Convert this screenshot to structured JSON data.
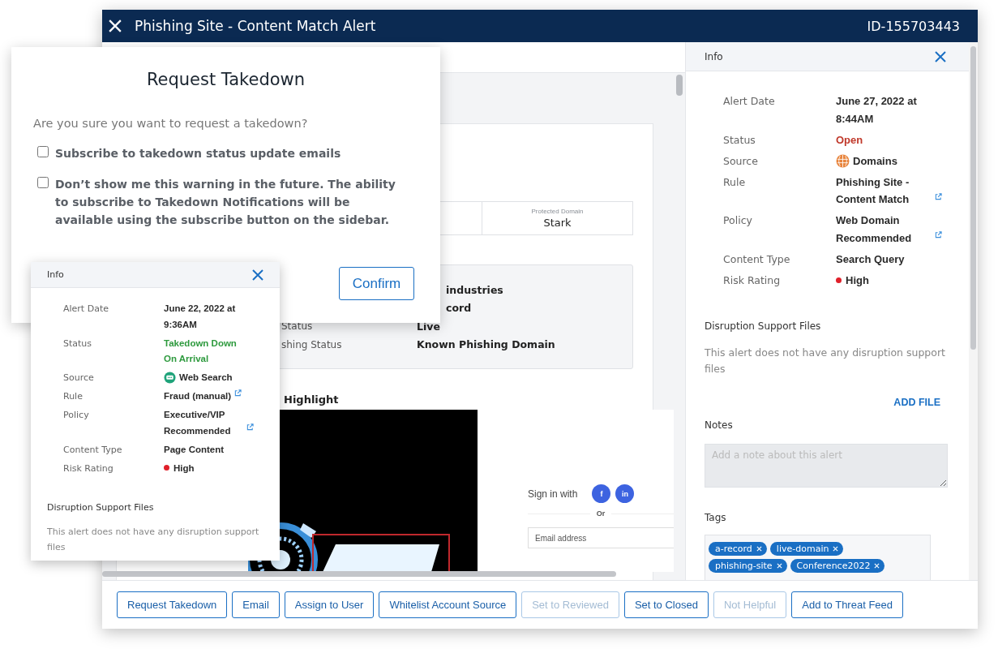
{
  "window": {
    "title": "Phishing Site - Content Match Alert",
    "id": "ID-155703443"
  },
  "alert_content": {
    "protected_domain": {
      "label": "Protected Domain",
      "value": "Stark"
    },
    "details": [
      {
        "value": "industries"
      },
      {
        "value": "cord"
      },
      {
        "label": "Status",
        "value": "Live"
      },
      {
        "label": "shing Status",
        "value": "Known Phishing Domain"
      }
    ],
    "highlight": {
      "title": "Highlight",
      "page": {
        "sign_in_label": "Sign in with",
        "social": [
          "f",
          "in"
        ],
        "separator": "Or",
        "email_placeholder": "Email address"
      }
    }
  },
  "info_panel": {
    "title": "Info",
    "fields": [
      {
        "kind": "text",
        "label": "Alert Date",
        "value": "June 27, 2022 at 8:44AM"
      },
      {
        "kind": "status",
        "label": "Status",
        "value": "Open",
        "color": "#c0392b"
      },
      {
        "kind": "source",
        "label": "Source",
        "value": "Domains",
        "color": "#e8843c"
      },
      {
        "kind": "link",
        "label": "Rule",
        "value": "Phishing Site - Content Match"
      },
      {
        "kind": "link",
        "label": "Policy",
        "value": "Web Domain Recommended"
      },
      {
        "kind": "text",
        "label": "Content Type",
        "value": "Search Query"
      },
      {
        "kind": "risk",
        "label": "Risk Rating",
        "value": "High",
        "color": "#e0202a"
      }
    ],
    "disruption": {
      "title": "Disruption Support Files",
      "empty_text": "This alert does not have any disruption support files",
      "add_button": "ADD FILE"
    },
    "notes": {
      "title": "Notes",
      "placeholder": "Add a note about this alert"
    },
    "tags": {
      "title": "Tags",
      "items": [
        "a-record",
        "live-domain",
        "phishing-site",
        "Conference2022"
      ]
    }
  },
  "actions": [
    {
      "label": "Request Takedown",
      "disabled": false
    },
    {
      "label": "Email",
      "disabled": false
    },
    {
      "label": "Assign to User",
      "disabled": false
    },
    {
      "label": "Whitelist Account Source",
      "disabled": false
    },
    {
      "label": "Set to Reviewed",
      "disabled": true
    },
    {
      "label": "Set to Closed",
      "disabled": false
    },
    {
      "label": "Not Helpful",
      "disabled": true
    },
    {
      "label": "Add to Threat Feed",
      "disabled": false
    }
  ],
  "takedown_dialog": {
    "title": "Request Takedown",
    "question": "Are you sure you want to request a takedown?",
    "options": [
      {
        "label": "Subscribe to takedown status update emails",
        "checked": false
      },
      {
        "label": "Don’t show me this warning in the future. The ability to subscribe to Takedown Notifications will be available using the subscribe button on the sidebar.",
        "checked": false
      }
    ],
    "confirm": "Confirm"
  },
  "info_popup": {
    "title": "Info",
    "fields": [
      {
        "kind": "text",
        "label": "Alert Date",
        "value": "June 22, 2022 at 9:36AM"
      },
      {
        "kind": "status",
        "label": "Status",
        "value": "Takedown Down On Arrival",
        "color": "#2e9a3e"
      },
      {
        "kind": "source",
        "label": "Source",
        "value": "Web Search",
        "color": "#1fa37a"
      },
      {
        "kind": "link",
        "label": "Rule",
        "value": "Fraud (manual)"
      },
      {
        "kind": "link",
        "label": "Policy",
        "value": "Executive/VIP Recommended"
      },
      {
        "kind": "text",
        "label": "Content Type",
        "value": "Page Content"
      },
      {
        "kind": "risk",
        "label": "Risk Rating",
        "value": "High",
        "color": "#e0202a"
      }
    ],
    "disruption": {
      "title": "Disruption Support Files",
      "empty_text": "This alert does not have any disruption support files"
    }
  }
}
